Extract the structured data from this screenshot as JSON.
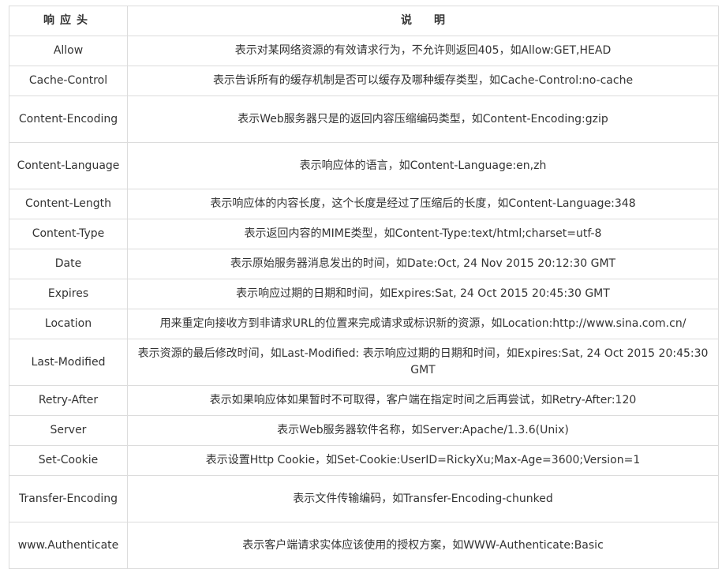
{
  "headers": [
    "响应头",
    "说明"
  ],
  "rows": [
    {
      "header": "Allow",
      "desc": "表示对某网络资源的有效请求行为，不允许则返回405，如Allow:GET,HEAD"
    },
    {
      "header": "Cache-Control",
      "desc": "表示告诉所有的缓存机制是否可以缓存及哪种缓存类型，如Cache-Control:no-cache"
    },
    {
      "header": "Content-Encoding",
      "desc": "表示Web服务器只是的返回内容压缩编码类型，如Content-Encoding:gzip"
    },
    {
      "header": "Content-Language",
      "desc": "表示响应体的语言，如Content-Language:en,zh"
    },
    {
      "header": "Content-Length",
      "desc": "表示响应体的内容长度，这个长度是经过了压缩后的长度，如Content-Language:348"
    },
    {
      "header": "Content-Type",
      "desc": "表示返回内容的MIME类型，如Content-Type:text/html;charset=utf-8"
    },
    {
      "header": "Date",
      "desc": "表示原始服务器消息发出的时间，如Date:Oct, 24 Nov 2015 20:12:30 GMT"
    },
    {
      "header": "Expires",
      "desc": "表示响应过期的日期和时间，如Expires:Sat, 24 Oct 2015 20:45:30 GMT"
    },
    {
      "header": "Location",
      "desc": "用来重定向接收方到非请求URL的位置来完成请求或标识新的资源，如Location:http://www.sina.com.cn/"
    },
    {
      "header": "Last-Modified",
      "desc": "表示资源的最后修改时间，如Last-Modified: 表示响应过期的日期和时间，如Expires:Sat, 24 Oct 2015 20:45:30 GMT"
    },
    {
      "header": "Retry-After",
      "desc": "表示如果响应体如果暂时不可取得，客户端在指定时间之后再尝试，如Retry-After:120"
    },
    {
      "header": "Server",
      "desc": "表示Web服务器软件名称，如Server:Apache/1.3.6(Unix)"
    },
    {
      "header": "Set-Cookie",
      "desc": "表示设置Http Cookie，如Set-Cookie:UserID=RickyXu;Max-Age=3600;Version=1"
    },
    {
      "header": "Transfer-Encoding",
      "desc": "表示文件传输编码，如Transfer-Encoding-chunked"
    },
    {
      "header": "www.Authenticate",
      "desc": "表示客户端请求实体应该使用的授权方案，如WWW-Authenticate:Basic"
    }
  ]
}
